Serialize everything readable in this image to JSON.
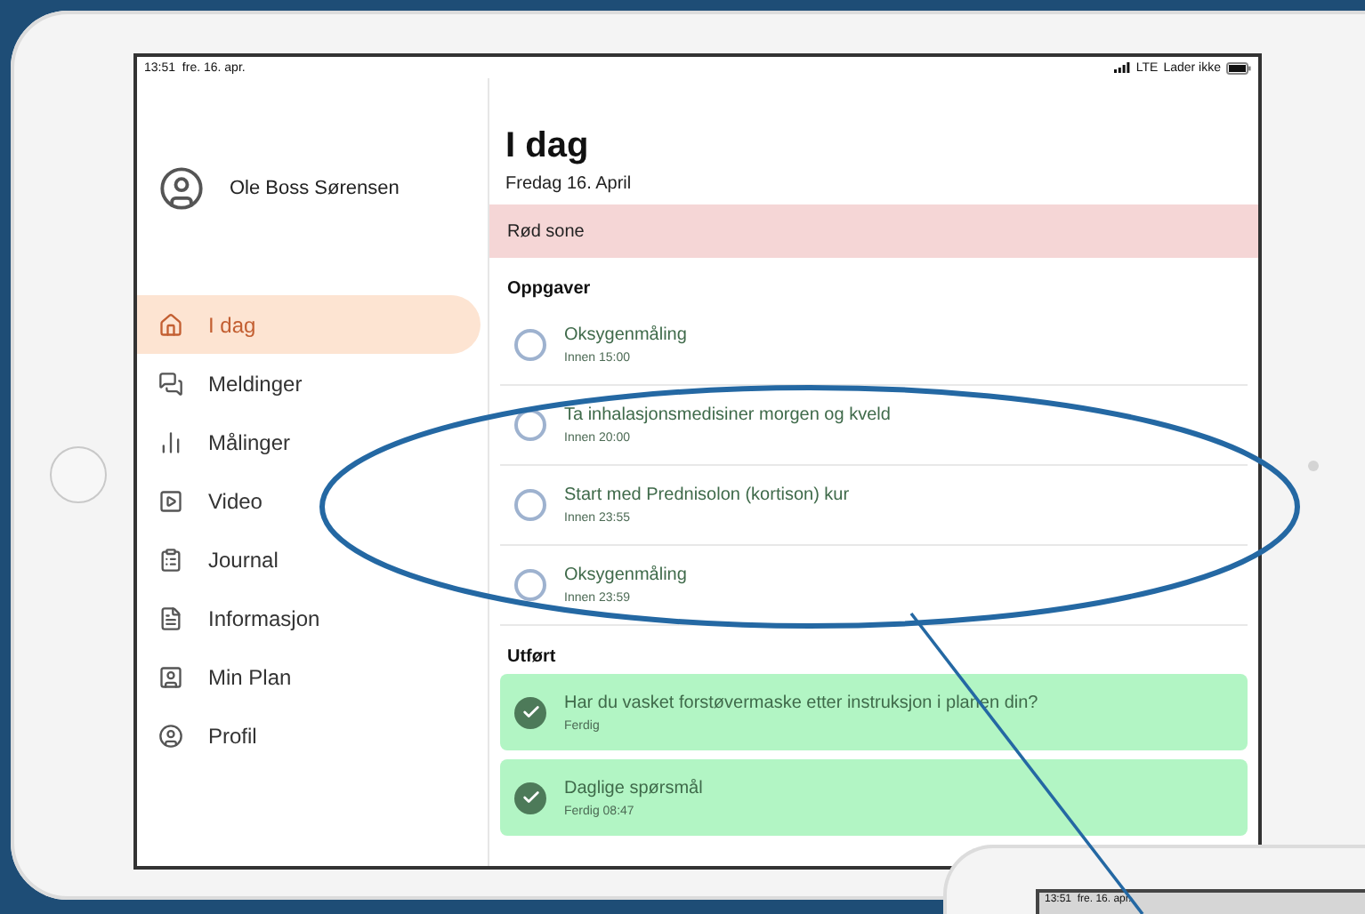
{
  "device_status": {
    "time": "13:51",
    "date": "fre. 16. apr.",
    "network": "LTE",
    "charging": "Lader ikke"
  },
  "user": {
    "name": "Ole Boss Sørensen"
  },
  "nav": [
    {
      "label": "I dag",
      "selected": true
    },
    {
      "label": "Meldinger",
      "selected": false
    },
    {
      "label": "Målinger",
      "selected": false
    },
    {
      "label": "Video",
      "selected": false
    },
    {
      "label": "Journal",
      "selected": false
    },
    {
      "label": "Informasjon",
      "selected": false
    },
    {
      "label": "Min Plan",
      "selected": false
    },
    {
      "label": "Profil",
      "selected": false
    }
  ],
  "page": {
    "title": "I dag",
    "date": "Fredag 16. April",
    "zone": {
      "label": "Rød sone",
      "kind": "red"
    }
  },
  "tasks": {
    "heading": "Oppgaver",
    "items": [
      {
        "title": "Oksygenmåling",
        "due": "Innen 15:00",
        "done": false
      },
      {
        "title": "Ta inhalasjonsmedisiner morgen og kveld",
        "due": "Innen 20:00",
        "done": false
      },
      {
        "title": "Start med Prednisolon (kortison) kur",
        "due": "Innen 23:55",
        "done": false
      },
      {
        "title": "Oksygenmåling",
        "due": "Innen 23:59",
        "done": false
      }
    ]
  },
  "completed": {
    "heading": "Utført",
    "items": [
      {
        "title": "Har du vasket forstøvermaske etter instruksjon i planen din?",
        "due": "Ferdig",
        "done": true
      },
      {
        "title": "Daglige spørsmål",
        "due": "Ferdig 08:47",
        "done": true
      }
    ]
  },
  "second_device": {
    "time": "13:51",
    "date": "fre. 16. apr."
  }
}
